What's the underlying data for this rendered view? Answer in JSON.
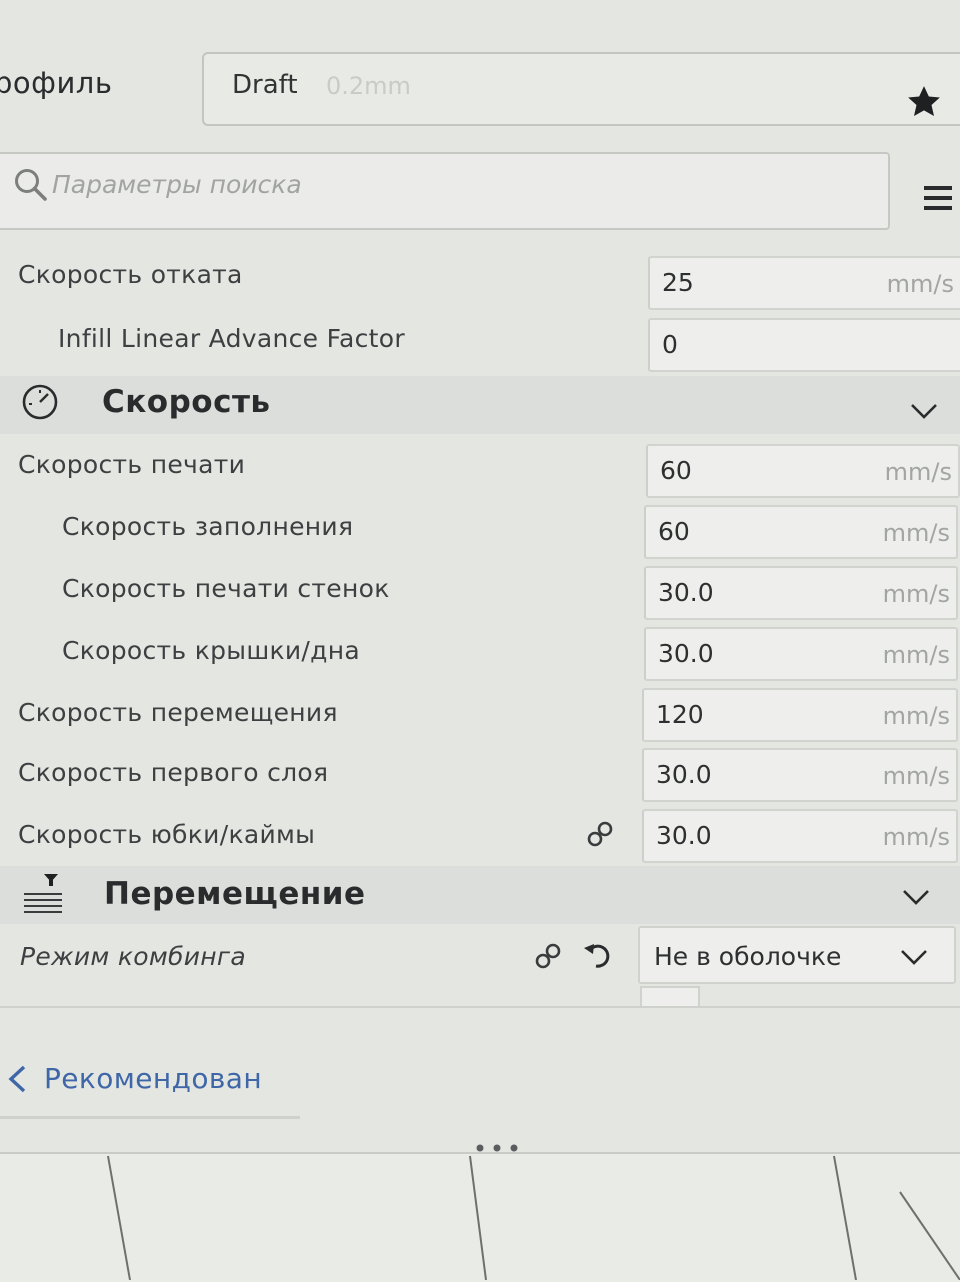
{
  "header": {
    "profile_label": "рофиль",
    "profile_name": "Draft",
    "profile_sub": "0.2mm"
  },
  "search": {
    "placeholder": "Параметры поиска"
  },
  "rows_top": [
    {
      "label": "Скорость отката",
      "value": "25",
      "unit": "mm/s"
    },
    {
      "label": "Infill Linear Advance Factor",
      "value": "0",
      "unit": ""
    }
  ],
  "section_speed": {
    "title": "Скорость"
  },
  "rows_speed": [
    {
      "label": "Скорость печати",
      "value": "60",
      "unit": "mm/s"
    },
    {
      "label": "Скорость заполнения",
      "value": "60",
      "unit": "mm/s"
    },
    {
      "label": "Скорость печати стенок",
      "value": "30.0",
      "unit": "mm/s"
    },
    {
      "label": "Скорость крышки/дна",
      "value": "30.0",
      "unit": "mm/s"
    },
    {
      "label": "Скорость перемещения",
      "value": "120",
      "unit": "mm/s"
    },
    {
      "label": "Скорость первого слоя",
      "value": "30.0",
      "unit": "mm/s"
    },
    {
      "label": "Скорость юбки/каймы",
      "value": "30.0",
      "unit": "mm/s"
    }
  ],
  "section_travel": {
    "title": "Перемещение"
  },
  "combing": {
    "label": "Режим комбинга",
    "value": "Не в оболочке"
  },
  "footer": {
    "recommended_label": "Рекомендован"
  },
  "icons": {
    "star": "star-icon",
    "search": "search-icon",
    "menu": "hamburger-menu-icon",
    "speed": "speedometer-icon",
    "travel": "travel-icon",
    "link": "link-icon",
    "reset": "reset-icon"
  },
  "colors": {
    "accent_link": "#3f67a8",
    "background": "#e4e6e2"
  }
}
